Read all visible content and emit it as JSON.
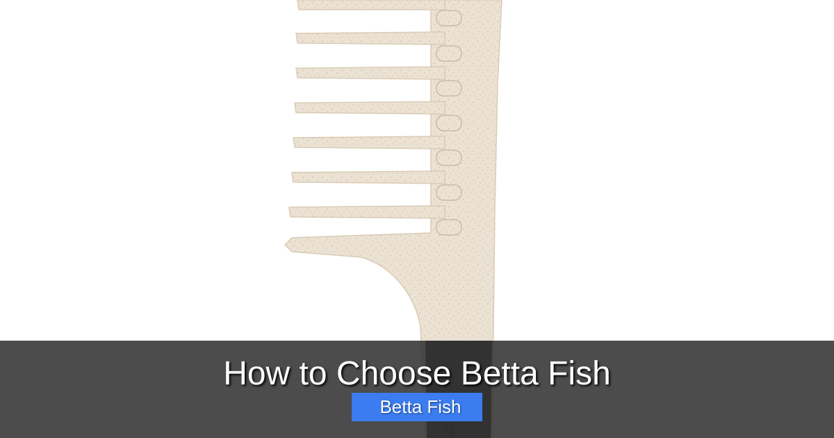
{
  "article": {
    "title": "How to Choose Betta Fish",
    "category_icon": "",
    "category": "Betta Fish"
  },
  "image": {
    "subject": "wide-tooth-comb-icon"
  },
  "colors": {
    "overlay": "#333333",
    "badge": "#3b7df0",
    "comb": "#ebe2d3",
    "handle": "#2a2a2a"
  }
}
